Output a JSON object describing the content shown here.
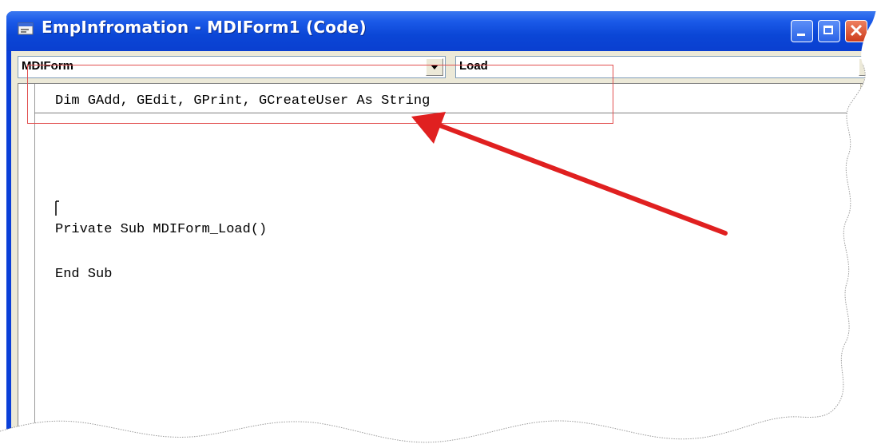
{
  "window": {
    "title": "EmpInfromation - MDIForm1 (Code)",
    "icons": {
      "app": "code-window-icon",
      "minimize": "minimize-icon",
      "maximize": "maximize-icon",
      "close": "close-icon"
    }
  },
  "toolbar": {
    "object_combo": {
      "value": "MDIForm",
      "icon": "chevron-down-icon"
    },
    "procedure_combo": {
      "value": "Load",
      "icon": "chevron-down-icon"
    }
  },
  "editor": {
    "declarations": "Dim GAdd, GEdit, GPrint, GCreateUser As String",
    "lines": [
      "Private Sub MDIForm_Load()",
      "End Sub"
    ]
  },
  "annotation": {
    "highlight_color": "#e15050",
    "arrow_color": "#e02020"
  },
  "colors": {
    "titlebar": "#0a3fd8",
    "chrome": "#ece9d8",
    "close_button": "#cc3c1c"
  }
}
